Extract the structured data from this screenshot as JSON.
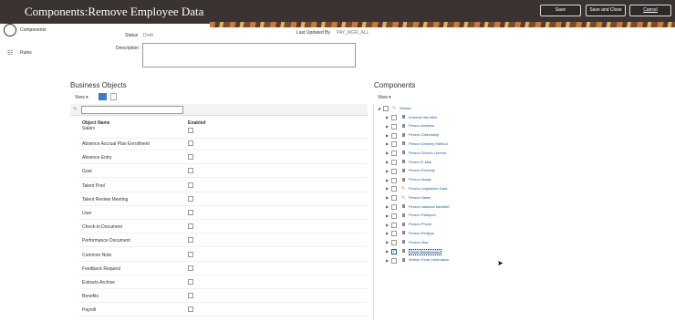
{
  "header": {
    "title": "Components:Remove Employee Data",
    "save": "Save",
    "save_close": "Save and Close",
    "cancel": "Cancel"
  },
  "rail": {
    "components": "Components",
    "rules": "Rules"
  },
  "form": {
    "status_label": "Status",
    "status_value": "Draft",
    "last_updated_label": "Last Updated By",
    "last_updated_value": "PAY_MGR_ALL",
    "description_label": "Description"
  },
  "business_objects": {
    "title": "Business Objects",
    "view": "View",
    "col_object": "Object Name",
    "col_enabled": "Enabled",
    "rows": [
      "Salary",
      "Absence Accrual Plan Enrollment",
      "Absence Entry",
      "Goal",
      "Talent Pool",
      "Talent Review Meeting",
      "User",
      "Check-in Document",
      "Performance Document",
      "Common Note",
      "Feedback Request",
      "Extracts Archive",
      "Benefits",
      "Payroll"
    ]
  },
  "components": {
    "title": "Components",
    "view": "View",
    "root": "Worker",
    "items": [
      "External Identifier",
      "Person Address",
      "Person Citizenship",
      "Person Delivery Method",
      "Person Drivers License",
      "Person E-Mail",
      "Person Ethnicity",
      "Person Image",
      "Person Legislative Data",
      "Person Name",
      "Person National Identifier",
      "Person Passport",
      "Person Phone",
      "Person Religion",
      "Person Visa",
      "Work Relationship",
      "Worker Extra Information"
    ]
  }
}
